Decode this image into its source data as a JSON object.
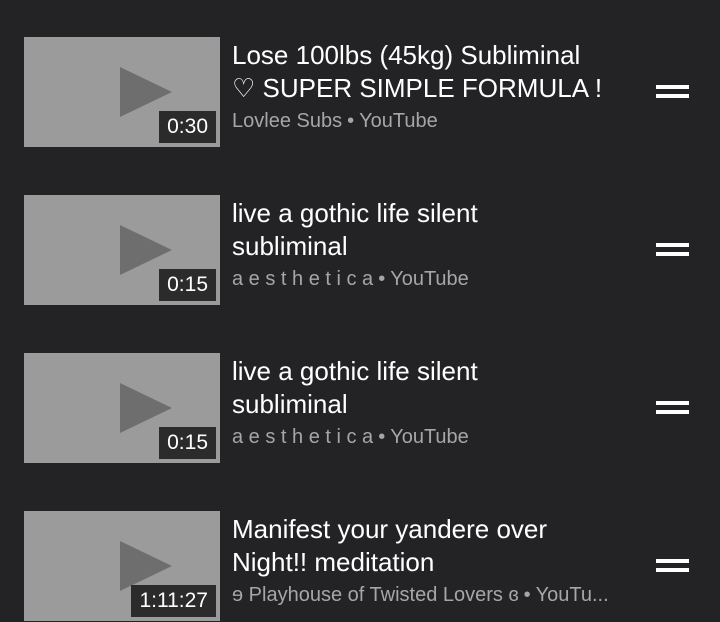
{
  "colors": {
    "background": "#232325",
    "thumbnail": "#9b9b9b",
    "play_glyph": "#6e6e6e",
    "title_text": "#ffffff",
    "meta_text": "#a6a6a6",
    "duration_badge": "#2b2b2b"
  },
  "icons": {
    "thumbnail": "play-icon",
    "reorder": "drag-handle-icon"
  },
  "items": [
    {
      "title": "Lose 100lbs (45kg) Subliminal\n♡ SUPER SIMPLE FORMULA !",
      "duration": "0:30",
      "channel": "Lovlee Subs",
      "separator": "•",
      "source": "YouTube"
    },
    {
      "title": "live a gothic life silent\nsubliminal",
      "duration": "0:15",
      "channel": "a e s t h e t i c a",
      "separator": "•",
      "source": "YouTube"
    },
    {
      "title": "live a gothic life silent\nsubliminal",
      "duration": "0:15",
      "channel": "a e s t h e t i c a",
      "separator": "•",
      "source": "YouTube"
    },
    {
      "title": "Manifest your yandere over\nNight!! meditation",
      "duration": "1:11:27",
      "channel": "ɘ Playhouse of Twisted Lovers ɞ",
      "separator": "•",
      "source": "YouTu..."
    }
  ]
}
